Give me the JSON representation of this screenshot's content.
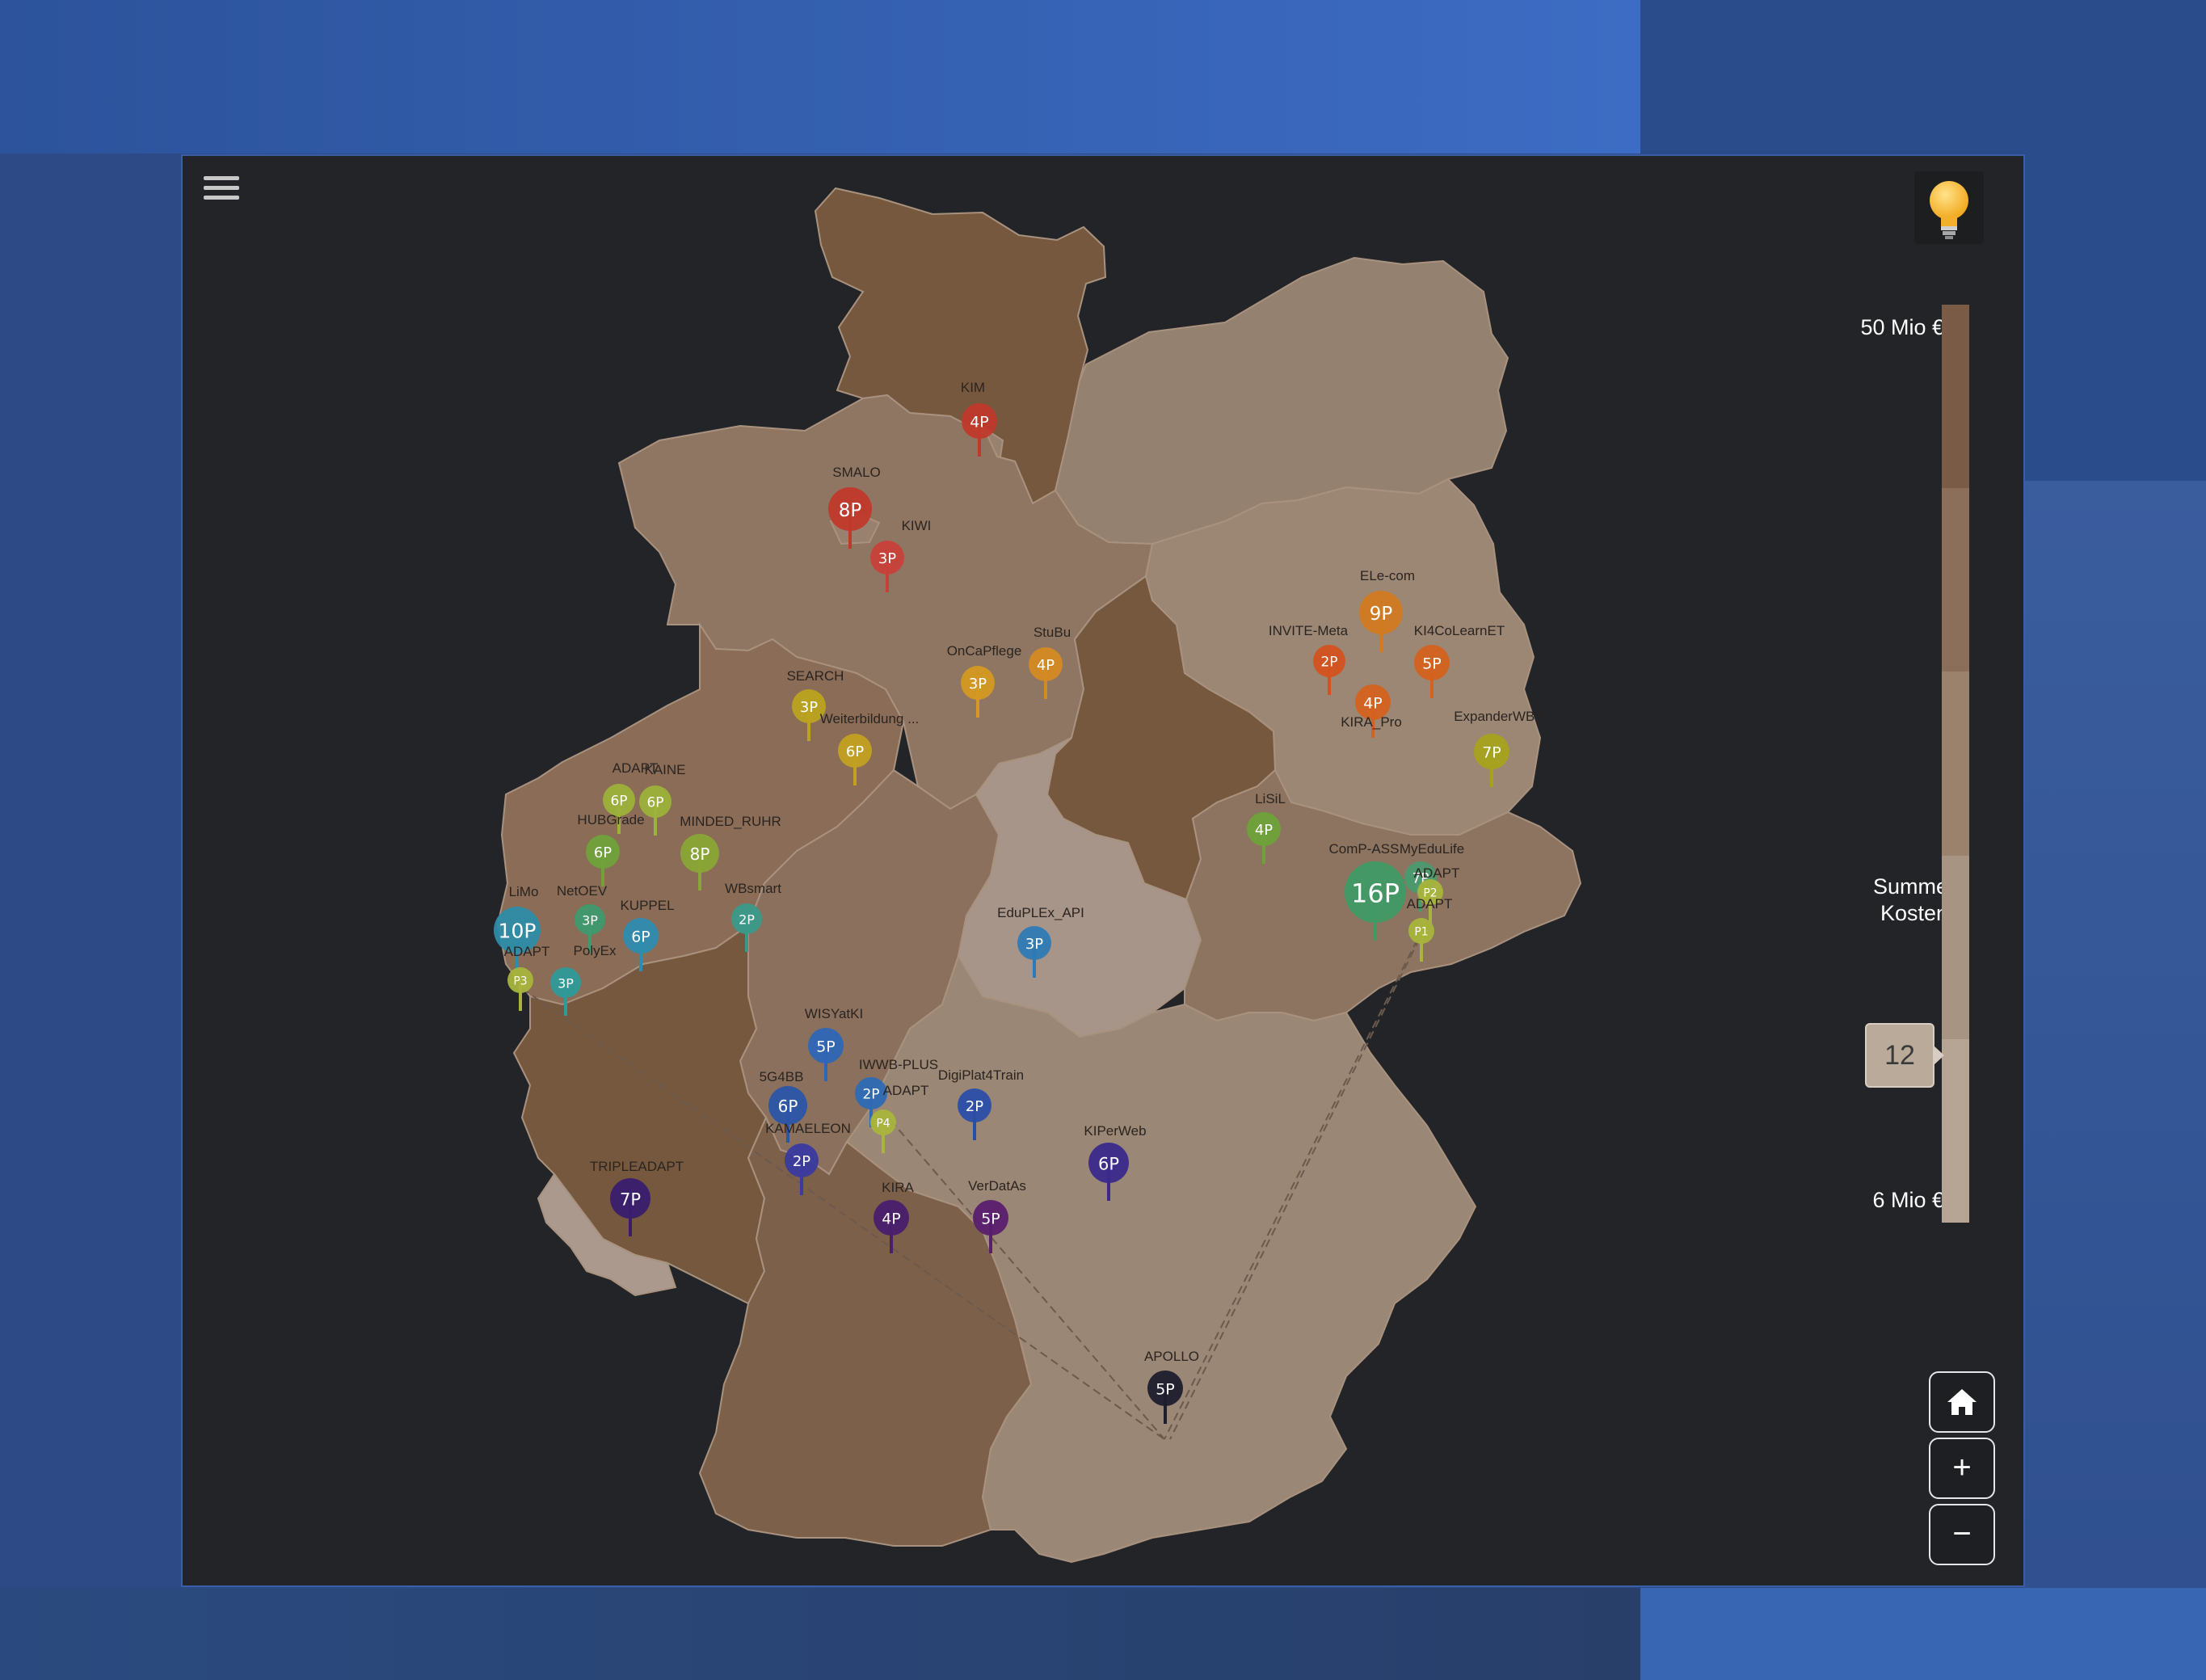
{
  "app": {
    "menu_icon": "hamburger-menu-icon",
    "hint_icon": "lightbulb-icon"
  },
  "legend": {
    "top_label": "50 Mio €",
    "mid_label_1": "Summe",
    "mid_label_2": "Kosten",
    "bottom_label": "6 Mio €",
    "value_badge": "12",
    "scale_colors": [
      "#7a5c46",
      "#8b6f5a",
      "#9a826d",
      "#a89482",
      "#b6a594"
    ]
  },
  "controls": {
    "home_icon": "home-icon",
    "zoom_in": "+",
    "zoom_out": "−"
  },
  "states": [
    {
      "name": "Schleswig-Holstein",
      "color": "#76583f"
    },
    {
      "name": "Hamburg",
      "color": "#98826f"
    },
    {
      "name": "Mecklenburg-Vorpommern",
      "color": "#958170"
    },
    {
      "name": "Niedersachsen",
      "color": "#8f7663"
    },
    {
      "name": "Bremen",
      "color": "#98826f"
    },
    {
      "name": "Berlin",
      "color": "#9c8775"
    },
    {
      "name": "Brandenburg",
      "color": "#9c8775"
    },
    {
      "name": "Sachsen-Anhalt",
      "color": "#76583f"
    },
    {
      "name": "Nordrhein-Westfalen",
      "color": "#8a6c57"
    },
    {
      "name": "Hessen",
      "color": "#8b705d"
    },
    {
      "name": "Thüringen",
      "color": "#a8958a"
    },
    {
      "name": "Sachsen",
      "color": "#8d7460"
    },
    {
      "name": "Rheinland-Pfalz",
      "color": "#76583f"
    },
    {
      "name": "Saarland",
      "color": "#aa998c"
    },
    {
      "name": "Baden-Württemberg",
      "color": "#7d6049"
    },
    {
      "name": "Bayern",
      "color": "#9b8776"
    }
  ],
  "markers": [
    {
      "name": "KIM",
      "count": "4P",
      "color": "#c0392b"
    },
    {
      "name": "SMALO",
      "count": "8P",
      "color": "#c0392b"
    },
    {
      "name": "KIWI",
      "count": "3P",
      "color": "#c9403a"
    },
    {
      "name": "ELe-com",
      "count": "9P",
      "color": "#d27a21"
    },
    {
      "name": "INVITE-Meta",
      "count": "2P",
      "color": "#d4521f"
    },
    {
      "name": "KI4CoLearnET",
      "count": "5P",
      "color": "#d4621f"
    },
    {
      "name": "KIRA_Pro",
      "count": "4P",
      "color": "#d4621f"
    },
    {
      "name": "ExpanderWB3",
      "count": "7P",
      "color": "#a6a21b"
    },
    {
      "name": "StuBu",
      "count": "4P",
      "color": "#d48a22"
    },
    {
      "name": "OnCaPflege",
      "count": "3P",
      "color": "#d49922"
    },
    {
      "name": "SEARCH",
      "count": "3P",
      "color": "#bba31f"
    },
    {
      "name": "Weiterbildung ...",
      "count": "6P",
      "color": "#c2a121"
    },
    {
      "name": "ADAPT",
      "count": "6P",
      "color": "#9cb23a"
    },
    {
      "name": "KAINE",
      "count": "6P",
      "color": "#9cb23a"
    },
    {
      "name": "HUBGrade",
      "count": "6P",
      "color": "#6fa23a"
    },
    {
      "name": "MINDED_RUHR",
      "count": "8P",
      "color": "#8aa636"
    },
    {
      "name": "LiSiL",
      "count": "4P",
      "color": "#6fa23a"
    },
    {
      "name": "ComP-ASS",
      "count": "16P",
      "color": "#3f9a66"
    },
    {
      "name": "MyEduLife",
      "count": "7P",
      "color": "#4a9a6e"
    },
    {
      "name": "ADAPT",
      "count": "P2",
      "color": "#a8b43c"
    },
    {
      "name": "ADAPT",
      "count": "P1",
      "color": "#a8b43c"
    },
    {
      "name": "NetOEV",
      "count": "3P",
      "color": "#3f9a6e"
    },
    {
      "name": "WBsmart",
      "count": "2P",
      "color": "#3a9a8a"
    },
    {
      "name": "KUPPEL",
      "count": "6P",
      "color": "#2e8cb0"
    },
    {
      "name": "LiMo",
      "count": "10P",
      "color": "#2e8ca8"
    },
    {
      "name": "ADAPT",
      "count": "P3",
      "color": "#a8b43c"
    },
    {
      "name": "PolyEx",
      "count": "3P",
      "color": "#2e9a9a"
    },
    {
      "name": "EduPLEx_API",
      "count": "3P",
      "color": "#2e7ab5"
    },
    {
      "name": "WISYatKI",
      "count": "5P",
      "color": "#2e66b5"
    },
    {
      "name": "IWWB-PLUS",
      "count": "2P",
      "color": "#2e6ab5"
    },
    {
      "name": "ADAPT",
      "count": "P4",
      "color": "#a8b43c"
    },
    {
      "name": "5G4BB",
      "count": "6P",
      "color": "#2a55a8"
    },
    {
      "name": "DigiPlat4Train",
      "count": "2P",
      "color": "#2a4ea8"
    },
    {
      "name": "KAMAELEON",
      "count": "2P",
      "color": "#3a3aa0"
    },
    {
      "name": "KIPerWeb",
      "count": "6P",
      "color": "#3a2a8c"
    },
    {
      "name": "TRIPLEADAPT",
      "count": "7P",
      "color": "#3a1e6e"
    },
    {
      "name": "KIRA",
      "count": "4P",
      "color": "#4a1e6e"
    },
    {
      "name": "VerDatAs",
      "count": "5P",
      "color": "#5a1e6e"
    },
    {
      "name": "APOLLO",
      "count": "5P",
      "color": "#1e1e2e"
    }
  ]
}
